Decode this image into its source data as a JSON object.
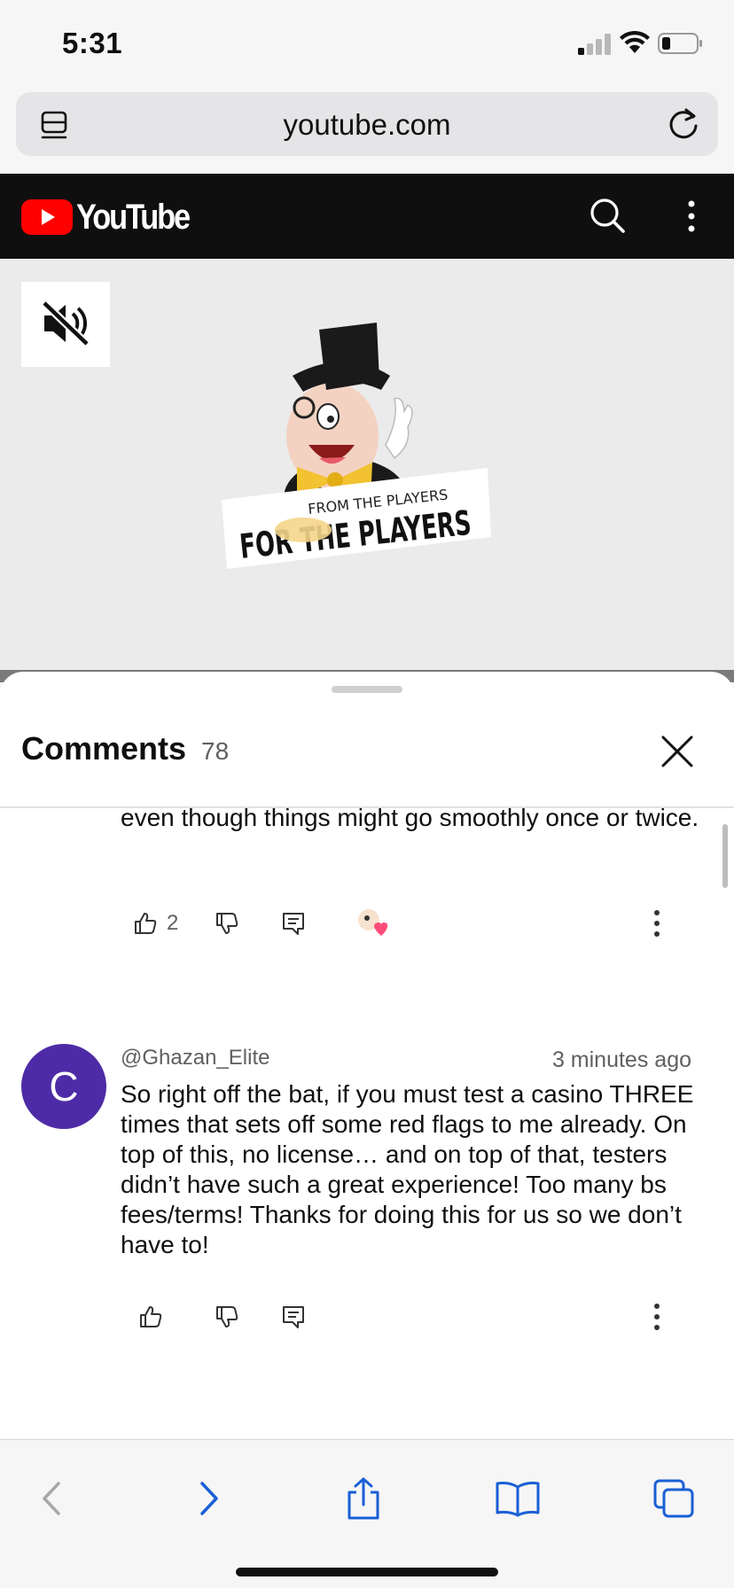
{
  "status_bar": {
    "time": "5:31"
  },
  "browser": {
    "url": "youtube.com"
  },
  "youtube": {
    "brand": "YouTube"
  },
  "video": {
    "thumbnail_caption_small": "FROM THE PLAYERS",
    "thumbnail_caption_large": "FOR THE PLAYERS"
  },
  "comments_panel": {
    "title": "Comments",
    "count": "78",
    "comments": [
      {
        "text": "even though things might go smoothly once or twice.",
        "likes": "2"
      },
      {
        "avatar_letter": "C",
        "author": "@Ghazan_Elite",
        "timestamp": "3 minutes ago",
        "text": "So right off the bat, if you must test a casino THREE times that sets off some red flags to me already. On top of this, no license… and on top of that, testers didn’t have such a great experience! Too many bs fees/terms! Thanks for doing this for us so we don’t have to!",
        "likes": ""
      }
    ]
  },
  "colors": {
    "youtube_red": "#ff0000",
    "avatar_purple": "#4e2ba6",
    "safari_blue": "#1a5fd6"
  }
}
